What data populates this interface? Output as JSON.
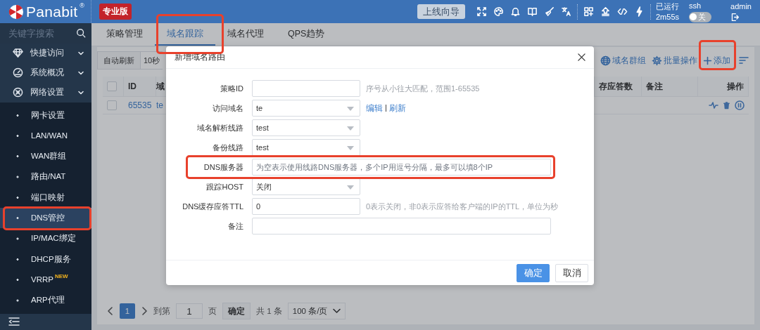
{
  "header": {
    "logo": "Panabit",
    "registered": "®",
    "edition": "专业版",
    "wizard_button": "上线向导",
    "uptime_label": "已运行",
    "uptime": "2m55s",
    "ssh_label": "ssh",
    "ssh_toggle": {
      "label": "关",
      "on": false
    },
    "user": "admin"
  },
  "sidebar": {
    "search": {
      "placeholder": "关键字搜索"
    },
    "groups": [
      {
        "label": "快捷访问",
        "expanded": false
      },
      {
        "label": "系统概况",
        "expanded": false
      },
      {
        "label": "网络设置",
        "expanded": true,
        "children": [
          {
            "label": "网卡设置",
            "selected": false,
            "highlighted": false
          },
          {
            "label": "LAN/WAN",
            "selected": false,
            "highlighted": false
          },
          {
            "label": "WAN群组",
            "selected": false,
            "highlighted": false
          },
          {
            "label": "路由/NAT",
            "selected": false,
            "highlighted": false
          },
          {
            "label": "端口映射",
            "selected": false,
            "highlighted": false
          },
          {
            "label": "DNS管控",
            "selected": true,
            "highlighted": true
          },
          {
            "label": "IP/MAC绑定",
            "selected": false,
            "highlighted": false
          },
          {
            "label": "DHCP服务",
            "selected": false,
            "highlighted": false
          },
          {
            "label": "VRRP",
            "badge": "NEW",
            "selected": false,
            "highlighted": false
          },
          {
            "label": "ARP代理",
            "selected": false,
            "highlighted": false
          }
        ]
      }
    ]
  },
  "tabs": [
    {
      "label": "策略管理",
      "selected": false,
      "highlighted": false
    },
    {
      "label": "域名跟踪",
      "selected": true,
      "highlighted": true
    },
    {
      "label": "域名代理",
      "selected": false,
      "highlighted": false
    },
    {
      "label": "QPS趋势",
      "selected": false,
      "highlighted": false
    }
  ],
  "toolbar": {
    "auto_refresh": "自动刷新",
    "interval": "10秒",
    "actions": [
      {
        "label": "域名群组",
        "highlighted": false
      },
      {
        "label": "批量操作",
        "highlighted": false
      },
      {
        "label": "添加",
        "highlighted": true
      }
    ]
  },
  "table": {
    "header_checked": false,
    "columns": [
      "ID",
      "域",
      "存应答数",
      "备注",
      "操作"
    ],
    "rows": [
      {
        "checked": false,
        "id": "65535",
        "domain": "te"
      }
    ]
  },
  "pagination": {
    "current": "1",
    "goto_label": "到第",
    "goto_value": "1",
    "page_unit": "页",
    "confirm": "确定",
    "total": "共 1 条",
    "page_size": "100 条/页"
  },
  "dialog": {
    "title": "新增域名路由",
    "fields": [
      {
        "label": "策略ID",
        "kind": "input",
        "hint": "序号从小往大匹配，范围1-65535",
        "highlighted": false
      },
      {
        "label": "访问域名",
        "kind": "select",
        "value": "te",
        "links": [
          "编辑",
          "刷新"
        ],
        "link_separator": "|",
        "highlighted": false
      },
      {
        "label": "域名解析线路",
        "kind": "select",
        "value": "test",
        "highlighted": false
      },
      {
        "label": "备份线路",
        "kind": "select",
        "value": "test",
        "highlighted": false
      },
      {
        "label": "DNS服务器",
        "kind": "wide_input",
        "placeholder": "为空表示使用线路DNS服务器，多个IP用逗号分隔，最多可以填8个IP",
        "highlighted": true
      },
      {
        "label": "跟踪HOST",
        "kind": "select",
        "value": "关闭",
        "highlighted": false
      },
      {
        "label": "DNS缓存应答TTL",
        "kind": "input",
        "value": "0",
        "hint": "0表示关闭，非0表示应答给客户端的IP的TTL，单位为秒",
        "highlighted": false
      },
      {
        "label": "备注",
        "kind": "wide_input",
        "highlighted": false
      }
    ],
    "buttons": [
      {
        "label": "确定",
        "primary": true
      },
      {
        "label": "取消",
        "primary": false
      }
    ]
  }
}
